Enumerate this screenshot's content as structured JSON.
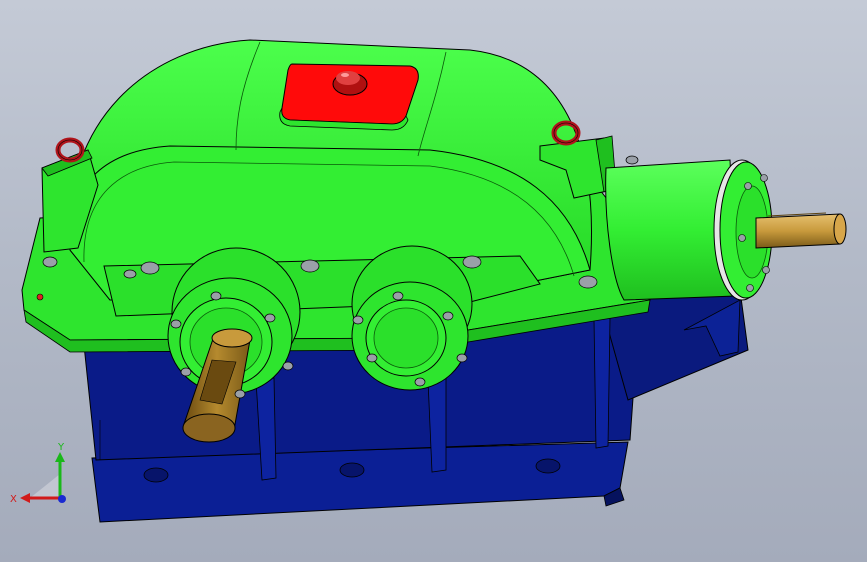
{
  "viewport": {
    "background_top": "#c4cad6",
    "background_bottom": "#a4abbb"
  },
  "model": {
    "parts": [
      {
        "name": "housing-cover",
        "color": "#33ee33"
      },
      {
        "name": "housing-base",
        "color": "#0b1f95"
      },
      {
        "name": "inspection-cover",
        "color": "#ff0a0a"
      },
      {
        "name": "breather-cap",
        "color": "#b01010"
      },
      {
        "name": "lifting-eye-bolt",
        "color": "#b0141b"
      },
      {
        "name": "input-shaft",
        "color": "#a0781e"
      },
      {
        "name": "output-shaft",
        "color": "#c89a3c"
      },
      {
        "name": "bolts",
        "color": "#9aa0a8"
      }
    ]
  },
  "triad": {
    "x_label": "X",
    "y_label": "Y",
    "x_color": "#d11a1a",
    "y_color": "#1ab81a",
    "z_color": "#1a2ad1"
  }
}
